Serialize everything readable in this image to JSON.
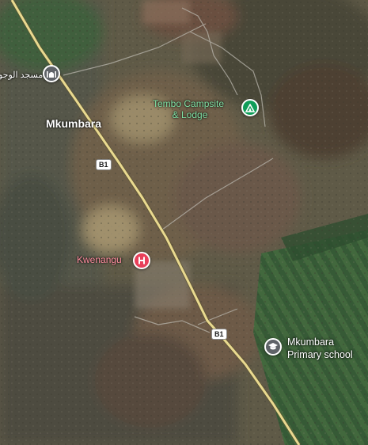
{
  "map": {
    "places": {
      "mosque": {
        "label": "مسجد الوجو",
        "icon": "mosque-icon",
        "color": "#5f6368"
      },
      "town": {
        "label": "Mkumbara"
      },
      "campsite": {
        "label_line1": "Tembo Campsite",
        "label_line2": "& Lodge",
        "icon": "campsite-tent-icon",
        "color": "#0f9d58",
        "label_color": "#7fe0a4"
      },
      "hospital": {
        "label": "Kwenangu",
        "icon": "hospital-h-icon",
        "color": "#e8405a",
        "label_color": "#ff8fa0"
      },
      "school": {
        "label_line1": "Mkumbara",
        "label_line2": "Primary school",
        "icon": "school-graduation-cap-icon",
        "color": "#5f6368"
      }
    },
    "road": {
      "name": "B1",
      "color": "#e9d98f"
    },
    "road_shields": [
      "B1",
      "B1"
    ]
  }
}
